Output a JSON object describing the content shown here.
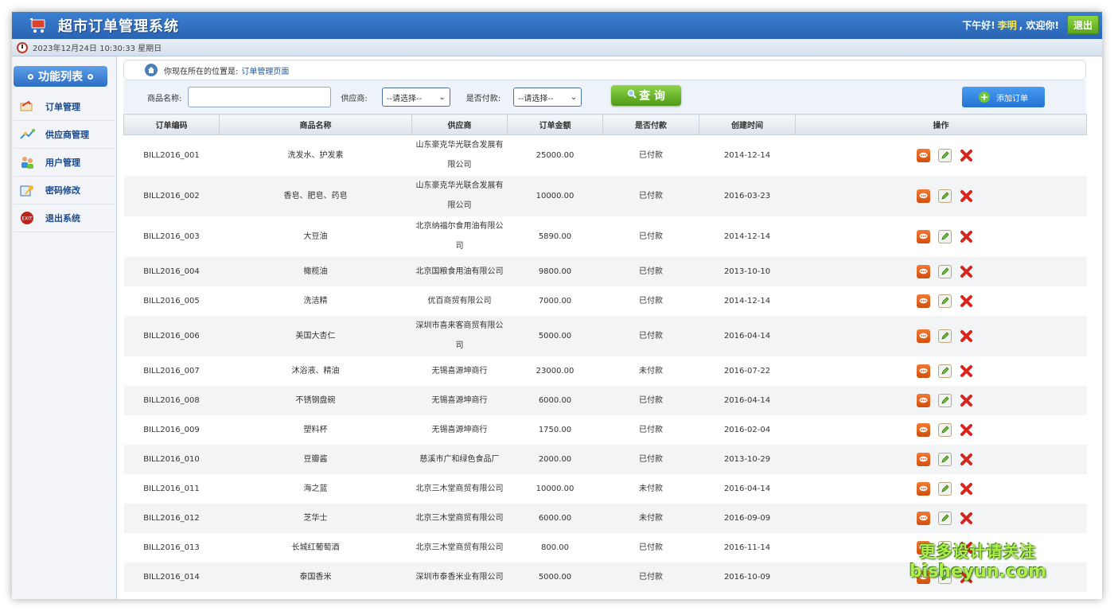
{
  "header": {
    "title": "超市订单管理系统",
    "greeting_prefix": "下午好!",
    "username": "李明",
    "greeting_suffix": ", 欢迎你!",
    "logout_label": "退出"
  },
  "timebar": {
    "datetime": "2023年12月24日 10:30:33 星期日"
  },
  "sidebar": {
    "title": "功能列表",
    "items": [
      {
        "label": "订单管理",
        "icon": "order-icon"
      },
      {
        "label": "供应商管理",
        "icon": "supplier-icon"
      },
      {
        "label": "用户管理",
        "icon": "users-icon"
      },
      {
        "label": "密码修改",
        "icon": "password-icon"
      },
      {
        "label": "退出系统",
        "icon": "exit-icon"
      }
    ]
  },
  "breadcrumb": {
    "prefix": "你现在所在的位置是:",
    "current": "订单管理页面"
  },
  "search": {
    "product_label": "商品名称:",
    "supplier_label": "供应商:",
    "supplier_selected": "--请选择--",
    "paid_label": "是否付款:",
    "paid_selected": "--请选择--",
    "query_label": "查 询",
    "add_label": "添加订单"
  },
  "table": {
    "headers": [
      "订单编码",
      "商品名称",
      "供应商",
      "订单金额",
      "是否付款",
      "创建时间",
      "操作"
    ],
    "rows": [
      {
        "code": "BILL2016_001",
        "product": "洗发水、护发素",
        "supplier": [
          "山东豪克华光联合发展有",
          "限公司"
        ],
        "amount": "25000.00",
        "paid": "已付款",
        "created": "2014-12-14"
      },
      {
        "code": "BILL2016_002",
        "product": "香皂、肥皂、药皂",
        "supplier": [
          "山东豪克华光联合发展有",
          "限公司"
        ],
        "amount": "10000.00",
        "paid": "已付款",
        "created": "2016-03-23"
      },
      {
        "code": "BILL2016_003",
        "product": "大豆油",
        "supplier": [
          "北京纳福尔食用油有限公",
          "司"
        ],
        "amount": "5890.00",
        "paid": "已付款",
        "created": "2014-12-14"
      },
      {
        "code": "BILL2016_004",
        "product": "橄榄油",
        "supplier": [
          "北京国粮食用油有限公司"
        ],
        "amount": "9800.00",
        "paid": "已付款",
        "created": "2013-10-10"
      },
      {
        "code": "BILL2016_005",
        "product": "洗洁精",
        "supplier": [
          "优百商贸有限公司"
        ],
        "amount": "7000.00",
        "paid": "已付款",
        "created": "2014-12-14"
      },
      {
        "code": "BILL2016_006",
        "product": "美国大杏仁",
        "supplier": [
          "深圳市喜来客商贸有限公",
          "司"
        ],
        "amount": "5000.00",
        "paid": "已付款",
        "created": "2016-04-14"
      },
      {
        "code": "BILL2016_007",
        "product": "沐浴液、精油",
        "supplier": [
          "无锡喜源坤商行"
        ],
        "amount": "23000.00",
        "paid": "未付款",
        "created": "2016-07-22"
      },
      {
        "code": "BILL2016_008",
        "product": "不锈钢盘碗",
        "supplier": [
          "无锡喜源坤商行"
        ],
        "amount": "6000.00",
        "paid": "已付款",
        "created": "2016-04-14"
      },
      {
        "code": "BILL2016_009",
        "product": "塑料杯",
        "supplier": [
          "无锡喜源坤商行"
        ],
        "amount": "1750.00",
        "paid": "已付款",
        "created": "2016-02-04"
      },
      {
        "code": "BILL2016_010",
        "product": "豆瓣酱",
        "supplier": [
          "慈溪市广和绿色食品厂"
        ],
        "amount": "2000.00",
        "paid": "已付款",
        "created": "2013-10-29"
      },
      {
        "code": "BILL2016_011",
        "product": "海之蓝",
        "supplier": [
          "北京三木堂商贸有限公司"
        ],
        "amount": "10000.00",
        "paid": "未付款",
        "created": "2016-04-14"
      },
      {
        "code": "BILL2016_012",
        "product": "芝华士",
        "supplier": [
          "北京三木堂商贸有限公司"
        ],
        "amount": "6000.00",
        "paid": "未付款",
        "created": "2016-09-09"
      },
      {
        "code": "BILL2016_013",
        "product": "长城红葡萄酒",
        "supplier": [
          "北京三木堂商贸有限公司"
        ],
        "amount": "800.00",
        "paid": "已付款",
        "created": "2016-11-14"
      },
      {
        "code": "BILL2016_014",
        "product": "泰国香米",
        "supplier": [
          "深圳市泰香米业有限公司"
        ],
        "amount": "5000.00",
        "paid": "已付款",
        "created": "2016-10-09"
      }
    ]
  },
  "watermark": {
    "line1": "更多设计请关注",
    "line2": "bisheyun.com"
  },
  "colors": {
    "header_blue": "#2a64b3",
    "link_blue": "#1a5aa8",
    "green_button": "#5aa61e",
    "delete_red": "#d9241c"
  }
}
